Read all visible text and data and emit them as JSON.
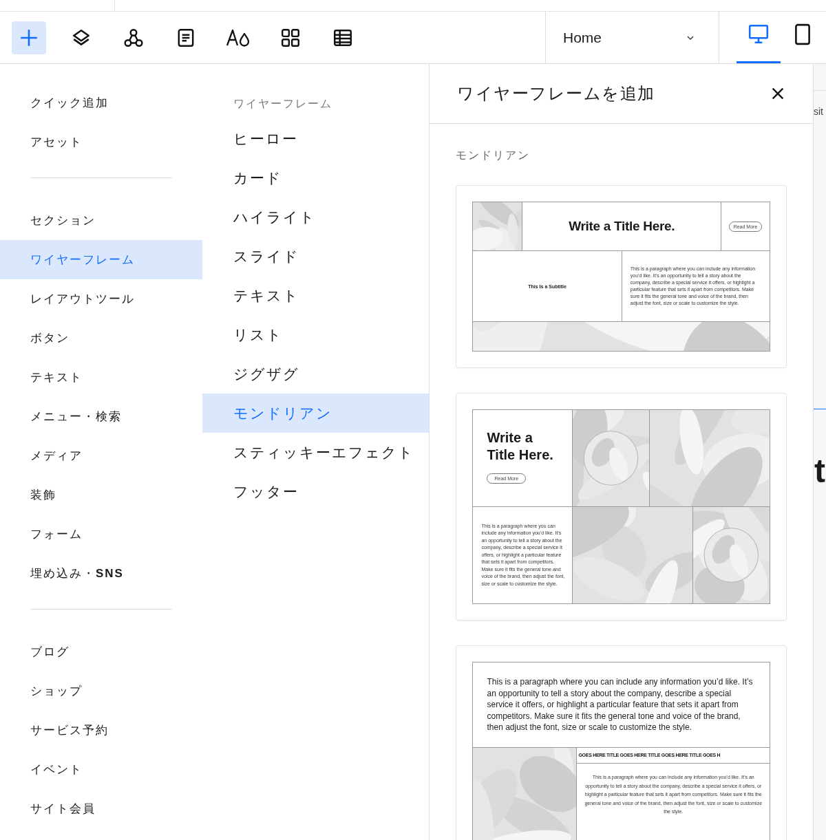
{
  "toolbar": {
    "tools": [
      {
        "kind": "add",
        "selected": true
      },
      {
        "kind": "layers",
        "selected": false
      },
      {
        "kind": "nodes",
        "selected": false
      },
      {
        "kind": "page",
        "selected": false
      },
      {
        "kind": "theme",
        "selected": false
      },
      {
        "kind": "apps",
        "selected": false
      },
      {
        "kind": "table",
        "selected": false
      }
    ],
    "page_selector": {
      "value": "Home"
    },
    "devices": [
      {
        "kind": "desktop",
        "selected": true
      },
      {
        "kind": "mobile",
        "selected": false
      }
    ]
  },
  "categories": [
    {
      "items": [
        {
          "label": "クイック追加",
          "selected": false
        },
        {
          "label": "アセット",
          "selected": false
        }
      ]
    },
    {
      "items": [
        {
          "label": "セクション",
          "selected": false
        },
        {
          "label": "ワイヤーフレーム",
          "selected": true
        },
        {
          "label": "レイアウトツール",
          "selected": false
        },
        {
          "label": "ボタン",
          "selected": false
        },
        {
          "label": "テキスト",
          "selected": false
        },
        {
          "label": "メニュー・検索",
          "selected": false
        },
        {
          "label": "メディア",
          "selected": false
        },
        {
          "label": "装飾",
          "selected": false
        },
        {
          "label": "フォーム",
          "selected": false
        },
        {
          "label": "埋め込み・**SNS**",
          "selected": false
        }
      ]
    },
    {
      "items": [
        {
          "label": "ブログ",
          "selected": false
        },
        {
          "label": "ショップ",
          "selected": false
        },
        {
          "label": "サービス予約",
          "selected": false
        },
        {
          "label": "イベント",
          "selected": false
        },
        {
          "label": "サイト会員",
          "selected": false
        }
      ]
    }
  ],
  "subcategories": {
    "heading": "ワイヤーフレーム",
    "items": [
      {
        "label": "ヒーロー",
        "selected": false
      },
      {
        "label": "カード",
        "selected": false
      },
      {
        "label": "ハイライト",
        "selected": false
      },
      {
        "label": "スライド",
        "selected": false
      },
      {
        "label": "テキスト",
        "selected": false
      },
      {
        "label": "リスト",
        "selected": false
      },
      {
        "label": "ジグザグ",
        "selected": false
      },
      {
        "label": "モンドリアン",
        "selected": true
      },
      {
        "label": "スティッキーエフェクト",
        "selected": false
      },
      {
        "label": "フッター",
        "selected": false
      }
    ]
  },
  "add_panel": {
    "title": "ワイヤーフレームを追加",
    "section_label": "モンドリアン",
    "templates": [
      {
        "kind": "banner",
        "title": "Write a Title Here.",
        "button": "Read More",
        "subtitle": "This Is a Subtitle",
        "paragraph": "This is a paragraph where you can include any information you’d like. It’s an opportunity to tell a story about the company, describe a special service it offers, or highlight a particular feature that sets it apart from competitors. Make sure it fits the general tone and voice of the brand, then adjust the font, size or scale to customize the style."
      },
      {
        "kind": "grid",
        "title": "Write a Title Here.",
        "button": "Read More",
        "paragraph": "This is a paragraph where you can include any information you’d like. It’s an opportunity to tell a story about the company, describe a special service it offers, or highlight a particular feature that sets it apart from competitors. Make sure it fits the general tone and voice of the brand, then adjust the font, size or scale to customize the style."
      },
      {
        "kind": "marquee",
        "paragraph": "This is a paragraph where you can include any information you’d like. It’s an opportunity to tell a story about the company, describe a special service it offers, or highlight a particular feature that sets it apart from competitors. Make sure it fits the general tone and voice of the brand, then adjust the font, size or scale to customize the style.",
        "marquee": "GOES HERE TITLE GOES HERE TITLE GOES HERE TITLE GOES H",
        "paragraph_2": "This is a paragraph where you can include any information you’d like. It’s an opportunity to tell a story about the company, describe a special service it offers, or highlight a particular feature that sets it apart from competitors. Make sure it fits the general tone and voice of the brand, then adjust the font, size or scale to customize the style."
      }
    ]
  },
  "canvas_peek": {
    "label": "sit",
    "heading": "t"
  }
}
